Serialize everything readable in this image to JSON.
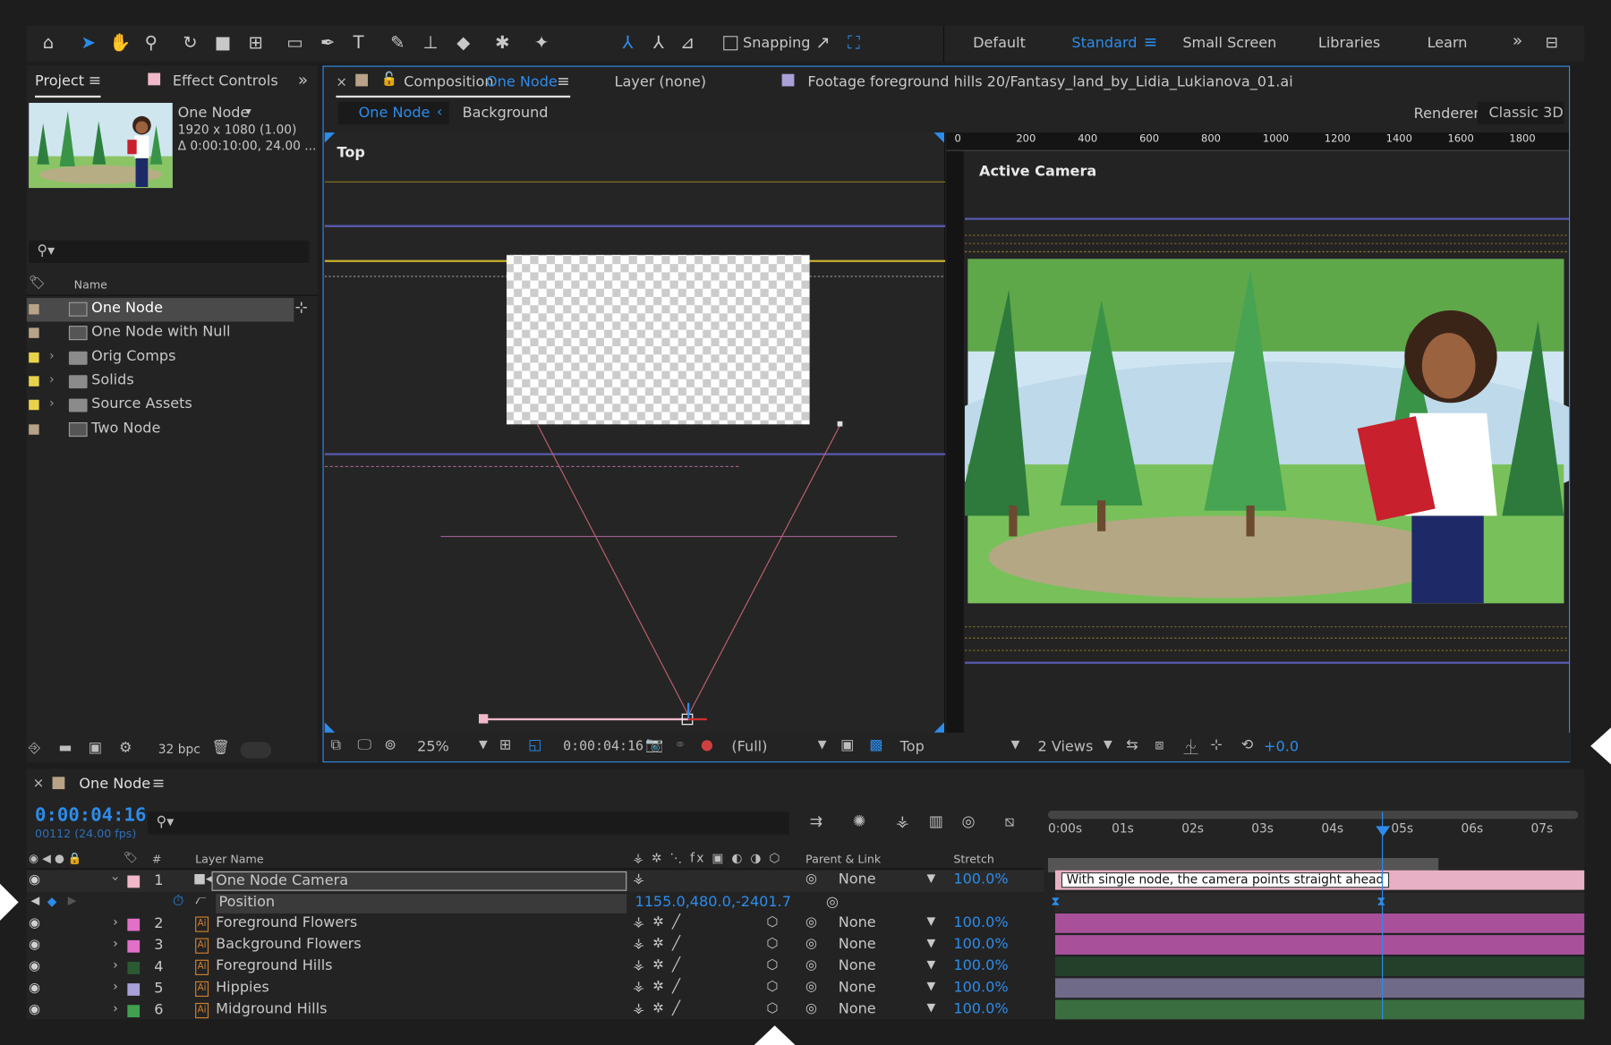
{
  "workspaces": [
    "Default",
    "Standard",
    "Small Screen",
    "Libraries",
    "Learn"
  ],
  "toolbar": {
    "snapping_label": "Snapping"
  },
  "project_panel": {
    "tab_project": "Project",
    "tab_effect_controls": "Effect Controls",
    "comp_name": "One Node",
    "comp_res": "1920 x 1080 (1.00)",
    "comp_dur": "Δ 0:00:10:00, 24.00 ...",
    "col_name": "Name",
    "items": [
      {
        "label": "One Node",
        "type": "comp",
        "color": "#b8a288"
      },
      {
        "label": "One Node with Null",
        "type": "comp",
        "color": "#b8a288"
      },
      {
        "label": "Orig Comps",
        "type": "folder",
        "color": "#e8d24a"
      },
      {
        "label": "Solids",
        "type": "folder",
        "color": "#e8d24a"
      },
      {
        "label": "Source Assets",
        "type": "folder",
        "color": "#e8d24a"
      },
      {
        "label": "Two Node",
        "type": "comp",
        "color": "#b8a288"
      }
    ],
    "bpc": "32 bpc"
  },
  "viewer": {
    "comp_tab_prefix": "Composition",
    "comp_tab_name": "One Node",
    "layer_tab": "Layer (none)",
    "footage_tab": "Footage foreground hills 20/Fantasy_land_by_Lidia_Lukianova_01.ai",
    "breadcrumb_active": "One Node",
    "breadcrumb_next": "Background",
    "renderer_label": "Renderer:",
    "renderer_value": "Classic 3D",
    "left_view_label": "Top",
    "right_view_label": "Active Camera",
    "ruler_ticks": [
      "0",
      "200",
      "400",
      "600",
      "800",
      "1000",
      "1200",
      "1400",
      "1600",
      "1800"
    ],
    "zoom": "25%",
    "timecode": "0:00:04:16",
    "resolution": "(Full)",
    "view": "Top",
    "views": "2 Views",
    "exposure": "+0.0"
  },
  "timeline": {
    "comp_tab": "One Node",
    "timecode": "0:00:04:16",
    "frames": "00112 (24.00 fps)",
    "col_layer_name": "Layer Name",
    "col_parent": "Parent & Link",
    "col_stretch": "Stretch",
    "col_hash": "#",
    "time_labels": [
      "0:00s",
      "01s",
      "02s",
      "03s",
      "04s",
      "05s",
      "06s",
      "07s"
    ],
    "camera_layer": {
      "num": "1",
      "name": "One Node Camera",
      "parent": "None",
      "stretch": "100.0%",
      "color": "#f0b8c8"
    },
    "position_prop": {
      "label": "Position",
      "value": "1155.0,480.0,-2401.7"
    },
    "marker_comment": "With single node, the camera points straight ahead",
    "layers": [
      {
        "num": "2",
        "name": "Foreground Flowers",
        "parent": "None",
        "stretch": "100.0%",
        "color": "#e070c8",
        "bar": "#a8509a"
      },
      {
        "num": "3",
        "name": "Background Flowers",
        "parent": "None",
        "stretch": "100.0%",
        "color": "#e070c8",
        "bar": "#a8509a"
      },
      {
        "num": "4",
        "name": "Foreground Hills",
        "parent": "None",
        "stretch": "100.0%",
        "color": "#2a5a32",
        "bar": "#24402a"
      },
      {
        "num": "5",
        "name": "Hippies",
        "parent": "None",
        "stretch": "100.0%",
        "color": "#a8a0d8",
        "bar": "#6e6a88"
      },
      {
        "num": "6",
        "name": "Midground Hills",
        "parent": "None",
        "stretch": "100.0%",
        "color": "#40a050",
        "bar": "#3a6e40"
      }
    ]
  },
  "colors": {
    "accent": "#2d8ceb",
    "panel": "#232323",
    "bg": "#1d1d1d"
  }
}
